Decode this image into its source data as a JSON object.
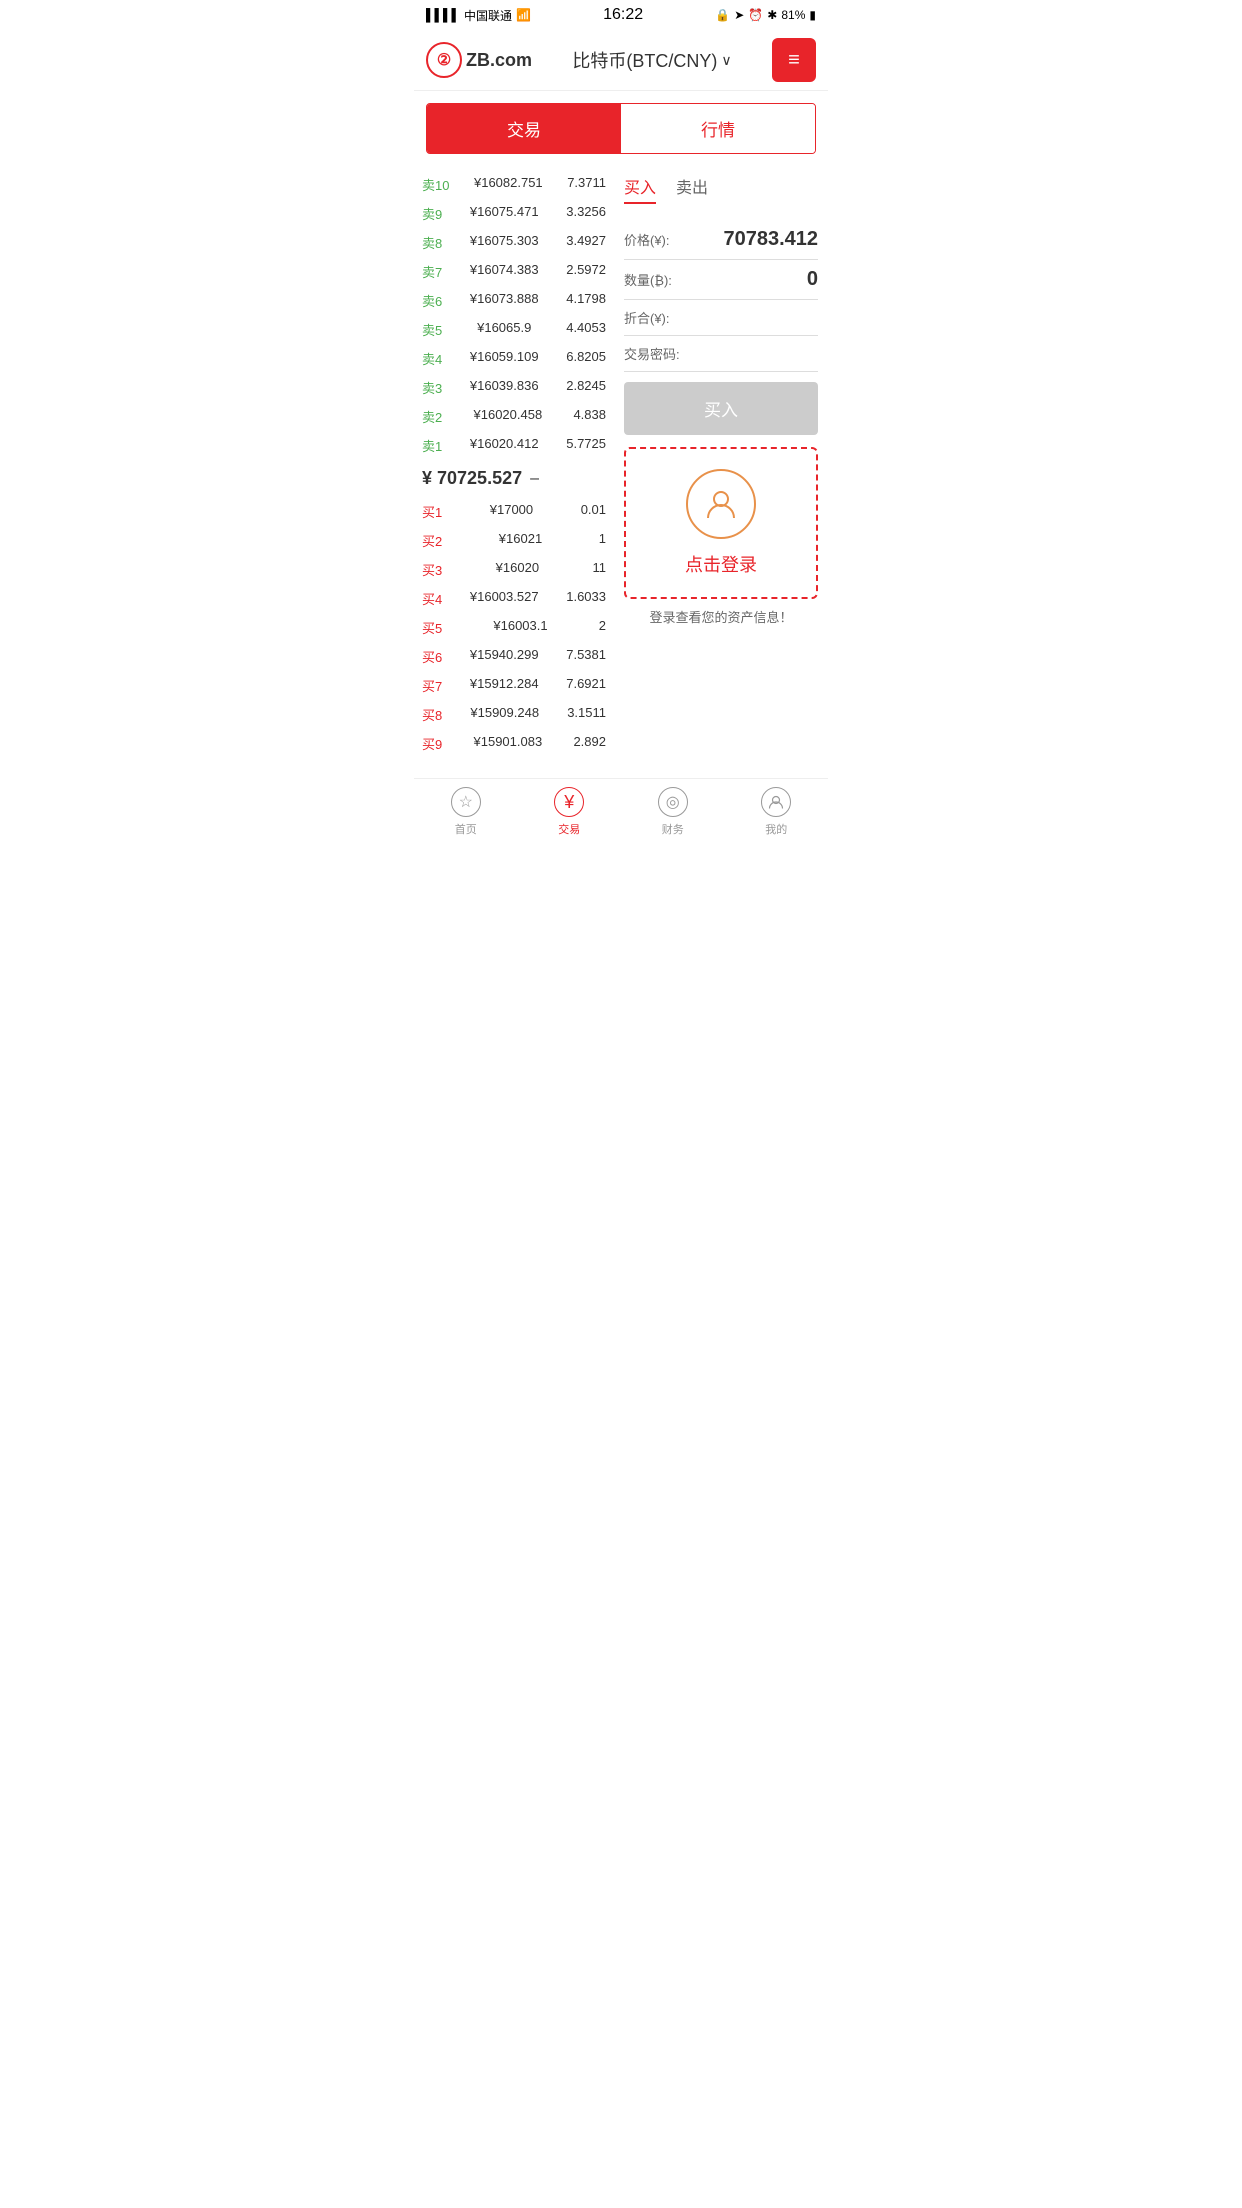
{
  "statusBar": {
    "carrier": "中国联通",
    "time": "16:22",
    "battery": "81%"
  },
  "header": {
    "logoText": "ZB",
    "domainText": ".com",
    "title": "比特币(BTC/CNY)",
    "menuLabel": "≡"
  },
  "tabs": {
    "tab1": "交易",
    "tab2": "行情"
  },
  "orderBook": {
    "sellOrders": [
      {
        "label": "卖10",
        "price": "¥16082.751",
        "qty": "7.3711"
      },
      {
        "label": "卖9",
        "price": "¥16075.471",
        "qty": "3.3256"
      },
      {
        "label": "卖8",
        "price": "¥16075.303",
        "qty": "3.4927"
      },
      {
        "label": "卖7",
        "price": "¥16074.383",
        "qty": "2.5972"
      },
      {
        "label": "卖6",
        "price": "¥16073.888",
        "qty": "4.1798"
      },
      {
        "label": "卖5",
        "price": "¥16065.9",
        "qty": "4.4053"
      },
      {
        "label": "卖4",
        "price": "¥16059.109",
        "qty": "6.8205"
      },
      {
        "label": "卖3",
        "price": "¥16039.836",
        "qty": "2.8245"
      },
      {
        "label": "卖2",
        "price": "¥16020.458",
        "qty": "4.838"
      },
      {
        "label": "卖1",
        "price": "¥16020.412",
        "qty": "5.7725"
      }
    ],
    "midPrice": "¥ 70725.527",
    "midIndicator": "–",
    "buyOrders": [
      {
        "label": "买1",
        "price": "¥17000",
        "qty": "0.01"
      },
      {
        "label": "买2",
        "price": "¥16021",
        "qty": "1"
      },
      {
        "label": "买3",
        "price": "¥16020",
        "qty": "11"
      },
      {
        "label": "买4",
        "price": "¥16003.527",
        "qty": "1.6033"
      },
      {
        "label": "买5",
        "price": "¥16003.1",
        "qty": "2"
      },
      {
        "label": "买6",
        "price": "¥15940.299",
        "qty": "7.5381"
      },
      {
        "label": "买7",
        "price": "¥15912.284",
        "qty": "7.6921"
      },
      {
        "label": "买8",
        "price": "¥15909.248",
        "qty": "3.1511"
      },
      {
        "label": "买9",
        "price": "¥15901.083",
        "qty": "2.892"
      }
    ]
  },
  "tradePanel": {
    "buyTab": "买入",
    "sellTab": "卖出",
    "priceLabel": "价格(¥):",
    "priceValue": "70783.412",
    "qtyLabel": "数量(₿):",
    "qtyValue": "0",
    "totalLabel": "折合(¥):",
    "totalValue": "",
    "passwordLabel": "交易密码:",
    "passwordValue": "",
    "buyButton": "买入"
  },
  "loginBox": {
    "loginText": "点击登录",
    "assetText": "登录查看您的资产信息！"
  },
  "bottomNav": [
    {
      "label": "首页",
      "icon": "☆",
      "active": false
    },
    {
      "label": "交易",
      "icon": "¥",
      "active": true
    },
    {
      "label": "财务",
      "icon": "◎",
      "active": false
    },
    {
      "label": "我的",
      "icon": "👤",
      "active": false
    }
  ]
}
